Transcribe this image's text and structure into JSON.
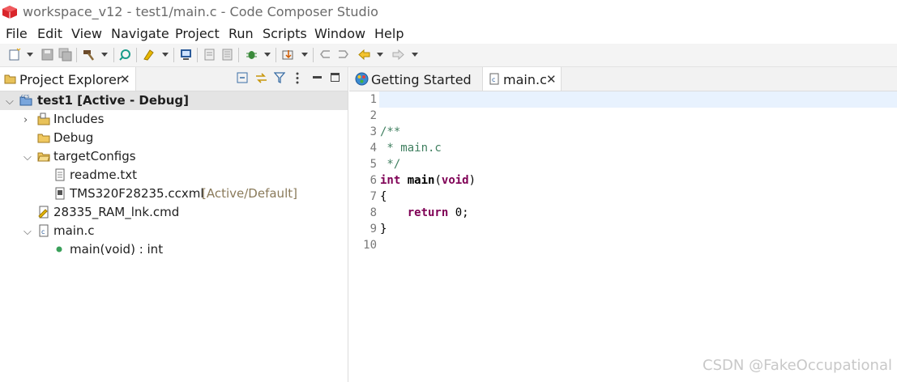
{
  "window": {
    "title": "workspace_v12 - test1/main.c - Code Composer Studio"
  },
  "menu": [
    "File",
    "Edit",
    "View",
    "Navigate",
    "Project",
    "Run",
    "Scripts",
    "Window",
    "Help"
  ],
  "explorer": {
    "tab_label": "Project Explorer",
    "tree": [
      {
        "label": "test1  [Active - Debug]",
        "icon": "project-icon",
        "bold": true,
        "expanded": true
      },
      {
        "label": "Includes",
        "icon": "includes-icon"
      },
      {
        "label": "Debug",
        "icon": "folder-icon"
      },
      {
        "label": "targetConfigs",
        "icon": "folder-icon",
        "expanded": true
      },
      {
        "label": "readme.txt",
        "icon": "text-file-icon"
      },
      {
        "label": "TMS320F28235.ccxml",
        "decoration": "[Active/Default]",
        "icon": "ccxml-file-icon"
      },
      {
        "label": "28335_RAM_lnk.cmd",
        "icon": "cmd-file-icon"
      },
      {
        "label": "main.c",
        "icon": "c-file-icon",
        "expanded": true
      },
      {
        "label": "main(void) : int",
        "icon": "function-icon"
      }
    ]
  },
  "editor": {
    "tabs": [
      {
        "label": "Getting Started",
        "active": false
      },
      {
        "label": "main.c",
        "active": true
      }
    ],
    "line_numbers": [
      "1",
      "2",
      "3",
      "4",
      "5",
      "6",
      "7",
      "8",
      "9",
      "10"
    ],
    "code": {
      "l3": "/**",
      "l4": " * main.c",
      "l5": " */",
      "l6_kw": "int",
      "l6_name": " main",
      "l6_paren_open": "(",
      "l6_void": "void",
      "l6_paren_close": ")",
      "l7": "{",
      "l8_indent": "    ",
      "l8_kw": "return",
      "l8_rest": " 0;",
      "l9": "}"
    }
  },
  "watermark": "CSDN @FakeOccupational",
  "colors": {
    "comment": "#3f7f5f",
    "keyword": "#7f0055",
    "current_line": "#e8f2fe",
    "decoration": "#8a7a5a"
  }
}
